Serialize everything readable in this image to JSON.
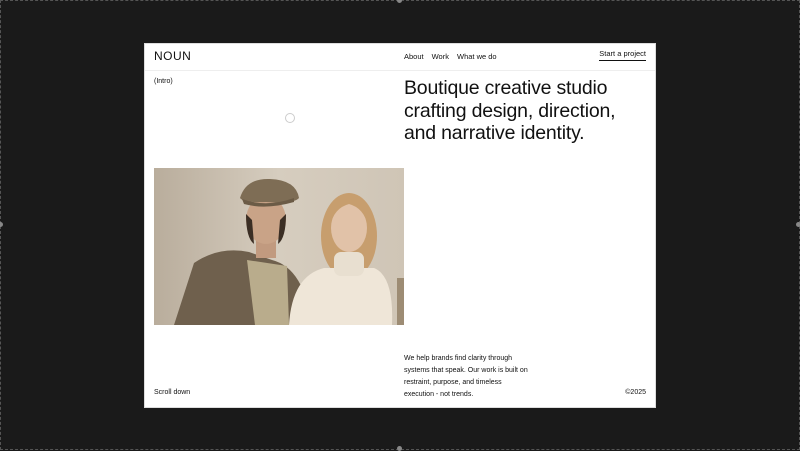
{
  "header": {
    "logo": "NOUN",
    "nav": [
      "About",
      "Work",
      "What we do"
    ],
    "cta": "Start a project"
  },
  "hero": {
    "label": "(Intro)",
    "headline": "Boutique creative studio crafting design, direction, and narrative identity."
  },
  "about": {
    "text": "We help brands find clarity through systems that speak. Our work is built on restraint, purpose, and timeless execution - not trends."
  },
  "footer": {
    "scroll": "Scroll down",
    "copyright": "©2025"
  }
}
